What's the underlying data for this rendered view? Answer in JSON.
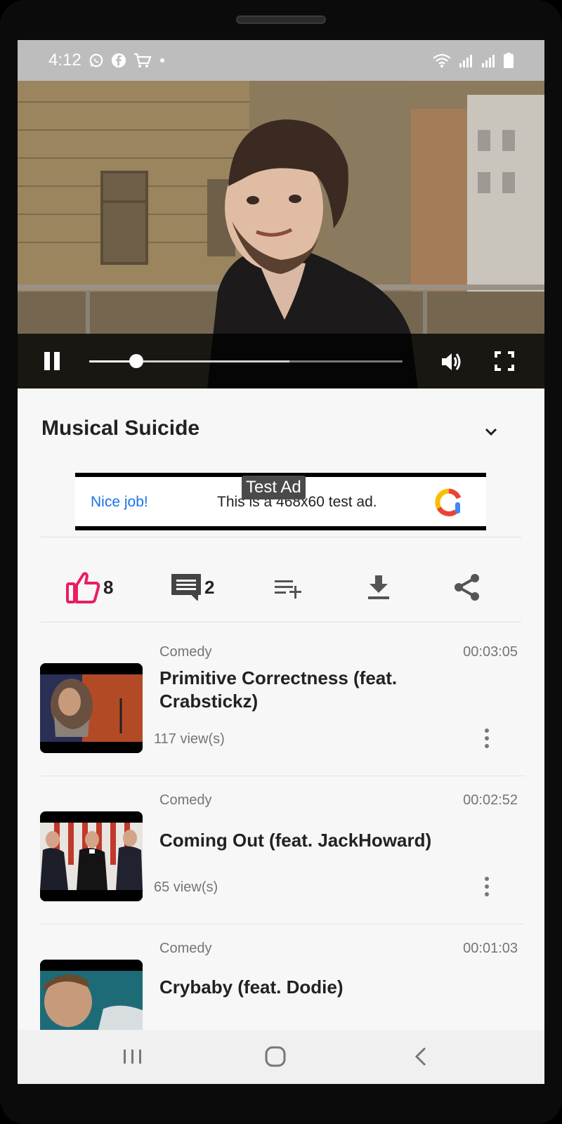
{
  "status_bar": {
    "time": "4:12",
    "icons": [
      "whatsapp-icon",
      "facebook-icon",
      "cart-icon",
      "dot-icon",
      "wifi-icon",
      "signal-icon",
      "signal-icon",
      "battery-icon"
    ]
  },
  "player": {
    "state": "playing",
    "progress": 0.15,
    "buffered": 0.64,
    "controls": [
      "pause-icon",
      "seek-bar",
      "volume-icon",
      "fullscreen-icon"
    ]
  },
  "video": {
    "title": "Musical Suicide"
  },
  "ad": {
    "badge": "Test Ad",
    "headline": "Nice job!",
    "message": "This is a 468x60 test ad."
  },
  "actions": {
    "likes": "8",
    "comments": "2",
    "icons": [
      "like-icon",
      "comment-icon",
      "playlist-add-icon",
      "download-icon",
      "share-icon"
    ]
  },
  "related": [
    {
      "category": "Comedy",
      "duration": "00:03:05",
      "title": "Primitive Correctness (feat. Crabstickz)",
      "views": "117 view(s)"
    },
    {
      "category": "Comedy",
      "duration": "00:02:52",
      "title": "Coming Out (feat. JackHoward)",
      "views": "65 view(s)"
    },
    {
      "category": "Comedy",
      "duration": "00:01:03",
      "title": "Crybaby (feat. Dodie)",
      "views": ""
    }
  ],
  "colors": {
    "accent_like": "#e91e63",
    "ad_link": "#1a73e8",
    "status_bar_bg": "#bdbdbd",
    "screen_bg": "#f7f7f7"
  }
}
